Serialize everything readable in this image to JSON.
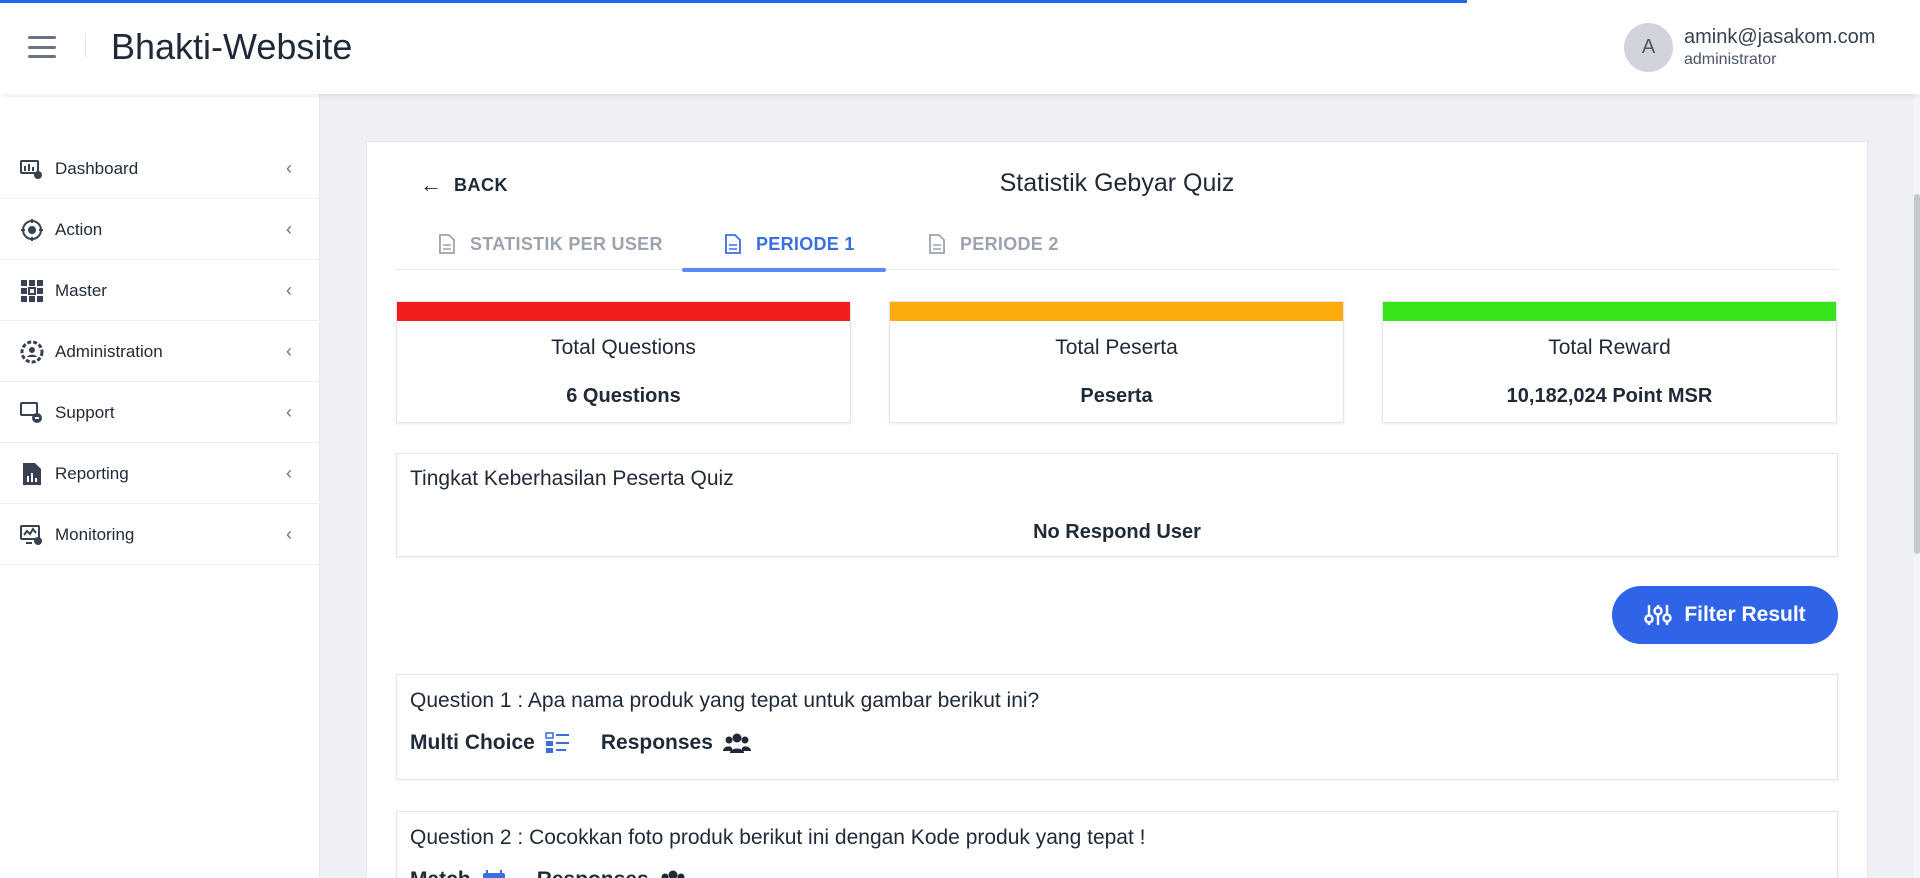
{
  "header": {
    "app_title": "Bhakti-Website",
    "avatar_initial": "A",
    "user_email": "amink@jasakom.com",
    "user_role": "administrator"
  },
  "sidebar": {
    "items": [
      {
        "label": "Dashboard",
        "icon": "dashboard-icon"
      },
      {
        "label": "Action",
        "icon": "action-icon"
      },
      {
        "label": "Master",
        "icon": "master-icon"
      },
      {
        "label": "Administration",
        "icon": "administration-icon"
      },
      {
        "label": "Support",
        "icon": "support-icon"
      },
      {
        "label": "Reporting",
        "icon": "reporting-icon"
      },
      {
        "label": "Monitoring",
        "icon": "monitoring-icon"
      }
    ]
  },
  "page": {
    "back_label": "BACK",
    "title": "Statistik Gebyar Quiz",
    "tabs": [
      {
        "label": "STATISTIK PER USER",
        "active": false
      },
      {
        "label": "PERIODE 1",
        "active": true
      },
      {
        "label": "PERIODE 2",
        "active": false
      }
    ]
  },
  "stats": [
    {
      "title": "Total Questions",
      "value": "6 Questions",
      "color": "#f41d1d"
    },
    {
      "title": "Total Peserta",
      "value": "Peserta",
      "color": "#fdab0d"
    },
    {
      "title": "Total Reward",
      "value": "10,182,024 Point MSR",
      "color": "#37e51a"
    }
  ],
  "success": {
    "title": "Tingkat Keberhasilan Peserta Quiz",
    "empty_text": "No Respond User"
  },
  "filter": {
    "label": "Filter Result"
  },
  "questions": [
    {
      "title": "Question 1 : Apa nama produk yang tepat untuk gambar berikut ini?",
      "type": "Multi Choice",
      "type_icon": "multi-choice-icon",
      "responses_label": "Responses"
    },
    {
      "title": "Question 2 : Cocokkan foto produk berikut ini dengan Kode produk yang tepat !",
      "type": "Match",
      "type_icon": "match-icon",
      "responses_label": "Responses"
    }
  ],
  "colors": {
    "accent": "#2f64e8",
    "tab_active": "#3b6fe0",
    "progress": "#2563eb"
  }
}
